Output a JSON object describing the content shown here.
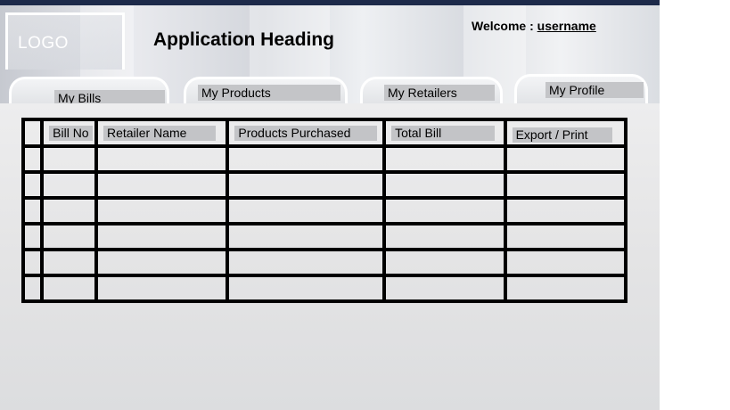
{
  "header": {
    "logo": "LOGO",
    "title": "Application Heading",
    "welcome_label": "Welcome :",
    "username": "username"
  },
  "tabs": [
    {
      "label": "My Bills"
    },
    {
      "label": "My Products"
    },
    {
      "label": "My Retailers"
    },
    {
      "label": "My Profile"
    }
  ],
  "table": {
    "columns": [
      "",
      "Bill No",
      "Retailer Name",
      "Products Purchased",
      "Total Bill",
      "Export / Print"
    ],
    "rows": [
      [
        "",
        "",
        "",
        "",
        "",
        ""
      ],
      [
        "",
        "",
        "",
        "",
        "",
        ""
      ],
      [
        "",
        "",
        "",
        "",
        "",
        ""
      ],
      [
        "",
        "",
        "",
        "",
        "",
        ""
      ],
      [
        "",
        "",
        "",
        "",
        "",
        ""
      ],
      [
        "",
        "",
        "",
        "",
        "",
        ""
      ]
    ]
  }
}
